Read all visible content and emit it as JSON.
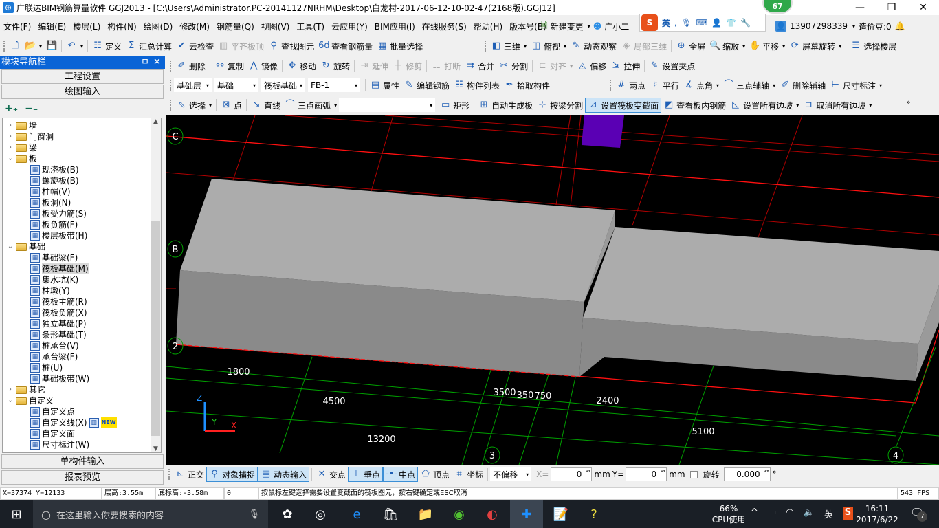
{
  "window": {
    "title": "广联达BIM钢筋算量软件 GGJ2013 - [C:\\Users\\Administrator.PC-20141127NRHM\\Desktop\\白龙村-2017-06-12-10-02-47(2168版).GGJ12]",
    "badge": "67",
    "minimize": "—",
    "restore": "❐",
    "close": "✕"
  },
  "menu": [
    "文件(F)",
    "编辑(E)",
    "楼层(L)",
    "构件(N)",
    "绘图(D)",
    "修改(M)",
    "钢筋量(Q)",
    "视图(V)",
    "工具(T)",
    "云应用(Y)",
    "BIM应用(I)",
    "在线服务(S)",
    "帮助(H)",
    "版本号(B)"
  ],
  "menu_right": {
    "new_change": "新建变更",
    "assistant": "广小二",
    "ime": "英",
    "phone": "13907298339",
    "beans": "造价豆:0"
  },
  "toolbars": {
    "main1": [
      {
        "icon": "new-file-icon",
        "g": "🗋"
      },
      {
        "icon": "open-folder-icon",
        "g": "📂",
        "dd": 1
      },
      {
        "icon": "save-icon",
        "g": "💾"
      },
      {
        "sep": 1
      },
      {
        "icon": "undo-icon",
        "g": "↶",
        "dd": 1
      },
      {
        "sep": 1
      },
      {
        "label": "定义",
        "icon": "define-icon",
        "g": "☷"
      },
      {
        "label": "汇总计算",
        "icon": "sigma-icon",
        "g": "Σ"
      },
      {
        "label": "云检查",
        "icon": "cloud-check-icon",
        "g": "✔"
      },
      {
        "label": "平齐板顶",
        "icon": "align-top-icon",
        "g": "▥",
        "dis": 1
      },
      {
        "label": "查找图元",
        "icon": "binoculars-icon",
        "g": "⚲"
      },
      {
        "label": "查看钢筋量",
        "icon": "glasses-icon",
        "g": "6d"
      },
      {
        "label": "批量选择",
        "icon": "batch-select-icon",
        "g": "▦"
      }
    ],
    "main2": [
      {
        "label": "三维",
        "icon": "cube-icon",
        "g": "◧",
        "dd": 1
      },
      {
        "label": "俯视",
        "icon": "top-view-icon",
        "g": "◫",
        "dd": 1
      },
      {
        "label": "动态观察",
        "icon": "orbit-icon",
        "g": "✎"
      },
      {
        "label": "局部三维",
        "icon": "local-3d-icon",
        "g": "◈",
        "dis": 1
      },
      {
        "sep": 1
      },
      {
        "label": "全屏",
        "icon": "fullscreen-icon",
        "g": "⊕"
      },
      {
        "label": "缩放",
        "icon": "zoom-icon",
        "g": "🔍",
        "dd": 1
      },
      {
        "label": "平移",
        "icon": "pan-icon",
        "g": "✋",
        "dd": 1
      },
      {
        "label": "屏幕旋转",
        "icon": "rotate-screen-icon",
        "g": "⟳",
        "dd": 1
      },
      {
        "sep": 1
      },
      {
        "label": "选择楼层",
        "icon": "select-floor-icon",
        "g": "☰"
      }
    ],
    "edit": [
      {
        "label": "删除",
        "icon": "delete-icon",
        "g": "✐"
      },
      {
        "sep": 1
      },
      {
        "label": "复制",
        "icon": "copy-icon",
        "g": "⚯"
      },
      {
        "label": "镜像",
        "icon": "mirror-icon",
        "g": "⋀"
      },
      {
        "sep": 1
      },
      {
        "label": "移动",
        "icon": "move-icon",
        "g": "✥"
      },
      {
        "label": "旋转",
        "icon": "rotate-icon",
        "g": "↻"
      },
      {
        "sep": 1
      },
      {
        "label": "延伸",
        "icon": "extend-icon",
        "g": "⇥",
        "dis": 1
      },
      {
        "label": "修剪",
        "icon": "trim-icon",
        "g": "╫",
        "dis": 1
      },
      {
        "sep": 1
      },
      {
        "label": "打断",
        "icon": "break-icon",
        "g": "⚋",
        "dis": 1
      },
      {
        "label": "合并",
        "icon": "merge-icon",
        "g": "⇉"
      },
      {
        "label": "分割",
        "icon": "split-icon",
        "g": "✂"
      },
      {
        "sep": 1
      },
      {
        "label": "对齐",
        "icon": "align-icon",
        "g": "⊏",
        "dis": 1,
        "dd": 1
      },
      {
        "label": "偏移",
        "icon": "offset-icon",
        "g": "◬"
      },
      {
        "label": "拉伸",
        "icon": "stretch-icon",
        "g": "⇲"
      },
      {
        "sep": 1
      },
      {
        "label": "设置夹点",
        "icon": "grip-point-icon",
        "g": "✎"
      }
    ],
    "component": {
      "combos": [
        {
          "name": "floor",
          "value": "基础层"
        },
        {
          "name": "category",
          "value": "基础"
        },
        {
          "name": "type",
          "value": "筏板基础"
        },
        {
          "name": "component",
          "value": "FB-1"
        }
      ],
      "items": [
        {
          "sep": 1
        },
        {
          "label": "属性",
          "icon": "properties-icon",
          "g": "▤"
        },
        {
          "label": "编辑钢筋",
          "icon": "edit-rebar-icon",
          "g": "✎"
        },
        {
          "label": "构件列表",
          "icon": "component-list-icon",
          "g": "☷"
        },
        {
          "label": "拾取构件",
          "icon": "eyedropper-icon",
          "g": "✒"
        }
      ]
    },
    "axis": [
      {
        "label": "两点",
        "icon": "two-point-axis-icon",
        "g": "#"
      },
      {
        "label": "平行",
        "icon": "parallel-axis-icon",
        "g": "♯"
      },
      {
        "label": "点角",
        "icon": "point-angle-icon",
        "g": "∡",
        "dd": 1
      },
      {
        "label": "三点辅轴",
        "icon": "three-point-axis-icon",
        "g": "⌒",
        "dd": 1
      },
      {
        "label": "删除辅轴",
        "icon": "delete-axis-icon",
        "g": "✐"
      },
      {
        "label": "尺寸标注",
        "icon": "dimension-icon",
        "g": "⊢",
        "dd": 1
      }
    ],
    "draw": [
      {
        "label": "选择",
        "icon": "cursor-icon",
        "g": "⇖",
        "dd": 1
      },
      {
        "sep": 1
      },
      {
        "label": "点",
        "icon": "point-icon",
        "g": "⊠"
      },
      {
        "sep": 1
      },
      {
        "label": "直线",
        "icon": "line-icon",
        "g": "↘"
      },
      {
        "label": "三点画弧",
        "icon": "arc-icon",
        "g": "⌒",
        "dd": 1
      },
      {
        "combo": ""
      },
      {
        "label": "矩形",
        "icon": "rectangle-icon",
        "g": "▭"
      },
      {
        "sep": 1
      },
      {
        "label": "自动生成板",
        "icon": "auto-slab-icon",
        "g": "⊞"
      },
      {
        "label": "按梁分割",
        "icon": "split-by-beam-icon",
        "g": "⊹"
      },
      {
        "label": "设置筏板变截面",
        "icon": "variable-section-icon",
        "g": "⊿",
        "act": 1
      },
      {
        "label": "查看板内钢筋",
        "icon": "view-rebar-icon",
        "g": "◩"
      },
      {
        "label": "设置所有边坡",
        "icon": "set-slope-icon",
        "g": "◺",
        "dd": 1
      },
      {
        "label": "取消所有边坡",
        "icon": "cancel-slope-icon",
        "g": "⊐",
        "dd": 1
      }
    ],
    "snap": [
      {
        "label": "正交",
        "icon": "orthogonal-icon",
        "g": "⊾"
      },
      {
        "label": "对象捕捉",
        "icon": "object-snap-icon",
        "g": "⚲",
        "act": 1
      },
      {
        "label": "动态输入",
        "icon": "dynamic-input-icon",
        "g": "▤",
        "act": 1
      },
      {
        "sep": 1
      },
      {
        "label": "交点",
        "icon": "intersection-icon",
        "g": "✕"
      },
      {
        "label": "垂点",
        "icon": "perpendicular-icon",
        "g": "⊥",
        "act": 1
      },
      {
        "label": "中点",
        "icon": "midpoint-icon",
        "g": "-•-",
        "act": 1
      },
      {
        "label": "顶点",
        "icon": "vertex-icon",
        "g": "⬠"
      },
      {
        "label": "坐标",
        "icon": "coordinate-icon",
        "g": "⌗"
      }
    ]
  },
  "snap_inputs": {
    "offset_mode": "不偏移",
    "x_label": "X=",
    "x_value": "0",
    "unit": "mm",
    "y_label": "Y=",
    "y_value": "0",
    "rotate_label": "旋转",
    "rotate_value": "0.000",
    "degree": "°"
  },
  "nav": {
    "title": "模块导航栏",
    "pin": "ㅁ",
    "close": "✕",
    "project_settings": "工程设置",
    "drawing_input": "绘图输入",
    "expand_all": "+₊",
    "collapse_all": "−₋",
    "single_input": "单构件输入",
    "report_preview": "报表预览"
  },
  "tree": [
    {
      "label": "墙",
      "level": 0,
      "folder": 1,
      "exp": "›"
    },
    {
      "label": "门窗洞",
      "level": 0,
      "folder": 1,
      "exp": "›"
    },
    {
      "label": "梁",
      "level": 0,
      "folder": 1,
      "exp": "›"
    },
    {
      "label": "板",
      "level": 0,
      "folder": 1,
      "exp": "⌄"
    },
    {
      "label": "现浇板(B)",
      "level": 1
    },
    {
      "label": "螺旋板(B)",
      "level": 1
    },
    {
      "label": "柱帽(V)",
      "level": 1
    },
    {
      "label": "板洞(N)",
      "level": 1
    },
    {
      "label": "板受力筋(S)",
      "level": 1
    },
    {
      "label": "板负筋(F)",
      "level": 1
    },
    {
      "label": "楼层板带(H)",
      "level": 1
    },
    {
      "label": "基础",
      "level": 0,
      "folder": 1,
      "exp": "⌄"
    },
    {
      "label": "基础梁(F)",
      "level": 1
    },
    {
      "label": "筏板基础(M)",
      "level": 1,
      "selected": 1
    },
    {
      "label": "集水坑(K)",
      "level": 1
    },
    {
      "label": "柱墩(Y)",
      "level": 1
    },
    {
      "label": "筏板主筋(R)",
      "level": 1
    },
    {
      "label": "筏板负筋(X)",
      "level": 1
    },
    {
      "label": "独立基础(P)",
      "level": 1
    },
    {
      "label": "条形基础(T)",
      "level": 1
    },
    {
      "label": "桩承台(V)",
      "level": 1
    },
    {
      "label": "承台梁(F)",
      "level": 1
    },
    {
      "label": "桩(U)",
      "level": 1
    },
    {
      "label": "基础板带(W)",
      "level": 1
    },
    {
      "label": "其它",
      "level": 0,
      "folder": 1,
      "exp": "›"
    },
    {
      "label": "自定义",
      "level": 0,
      "folder": 1,
      "exp": "⌄"
    },
    {
      "label": "自定义点",
      "level": 1
    },
    {
      "label": "自定义线(X)",
      "level": 1,
      "badge": "NEW"
    },
    {
      "label": "自定义面",
      "level": 1
    },
    {
      "label": "尺寸标注(W)",
      "level": 1
    }
  ],
  "viewport": {
    "axis_labels": [
      "C",
      "B",
      "2",
      "3",
      "4"
    ],
    "dimensions": [
      "1800",
      "4500",
      "3500",
      "350",
      "750",
      "2400",
      "13200",
      "5100"
    ],
    "triad": {
      "z": "Z",
      "y": "Y",
      "x": "X"
    },
    "colors": {
      "background": "#000000",
      "slab_top": "#acacac",
      "slab_front": "#8a8a8a",
      "column": "#5a00b4",
      "axis_red": "#ff0000",
      "dim_green": "#00a000"
    }
  },
  "status": {
    "coords": "X=37374 Y=12133",
    "floor_height": "层高:3.55m",
    "bottom_elev": "底标高:-3.58m",
    "value": "0",
    "hint": "按鼠标左键选择需要设置变截面的筏板图元，按右键确定或ESC取消",
    "fps": "543 FPS"
  },
  "taskbar": {
    "search_placeholder": "在这里输入你要搜索的内容",
    "cpu_percent": "66%",
    "cpu_label": "CPU使用",
    "ime": "英",
    "time": "16:11",
    "date": "2017/6/22",
    "notifications": "7"
  }
}
